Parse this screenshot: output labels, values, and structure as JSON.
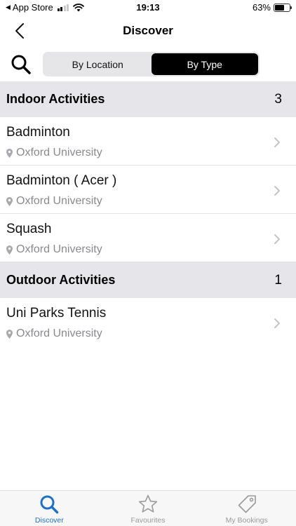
{
  "status_bar": {
    "carrier": "App Store",
    "time": "19:13",
    "battery": "63%",
    "battery_level": 0.63
  },
  "nav": {
    "title": "Discover",
    "back_icon": "chevron-left-icon"
  },
  "segmented": {
    "options": [
      "By Location",
      "By Type"
    ],
    "selected": "By Type"
  },
  "sections": [
    {
      "title": "Indoor Activities",
      "count": "3",
      "items": [
        {
          "title": "Badminton",
          "location": "Oxford University"
        },
        {
          "title": "Badminton ( Acer )",
          "location": "Oxford University"
        },
        {
          "title": "Squash",
          "location": "Oxford University"
        }
      ]
    },
    {
      "title": "Outdoor Activities",
      "count": "1",
      "items": [
        {
          "title": "Uni Parks Tennis",
          "location": "Oxford University"
        }
      ]
    }
  ],
  "tab_bar": {
    "tabs": [
      {
        "label": "Discover",
        "icon": "search-icon",
        "active": true
      },
      {
        "label": "Favourites",
        "icon": "star-icon",
        "active": false
      },
      {
        "label": "My Bookings",
        "icon": "tag-icon",
        "active": false
      }
    ]
  },
  "colors": {
    "accent": "#1e6fc7",
    "section_bg": "#e6e6ea",
    "subtitle": "#8a8a8e",
    "segment_active": "#000000"
  }
}
